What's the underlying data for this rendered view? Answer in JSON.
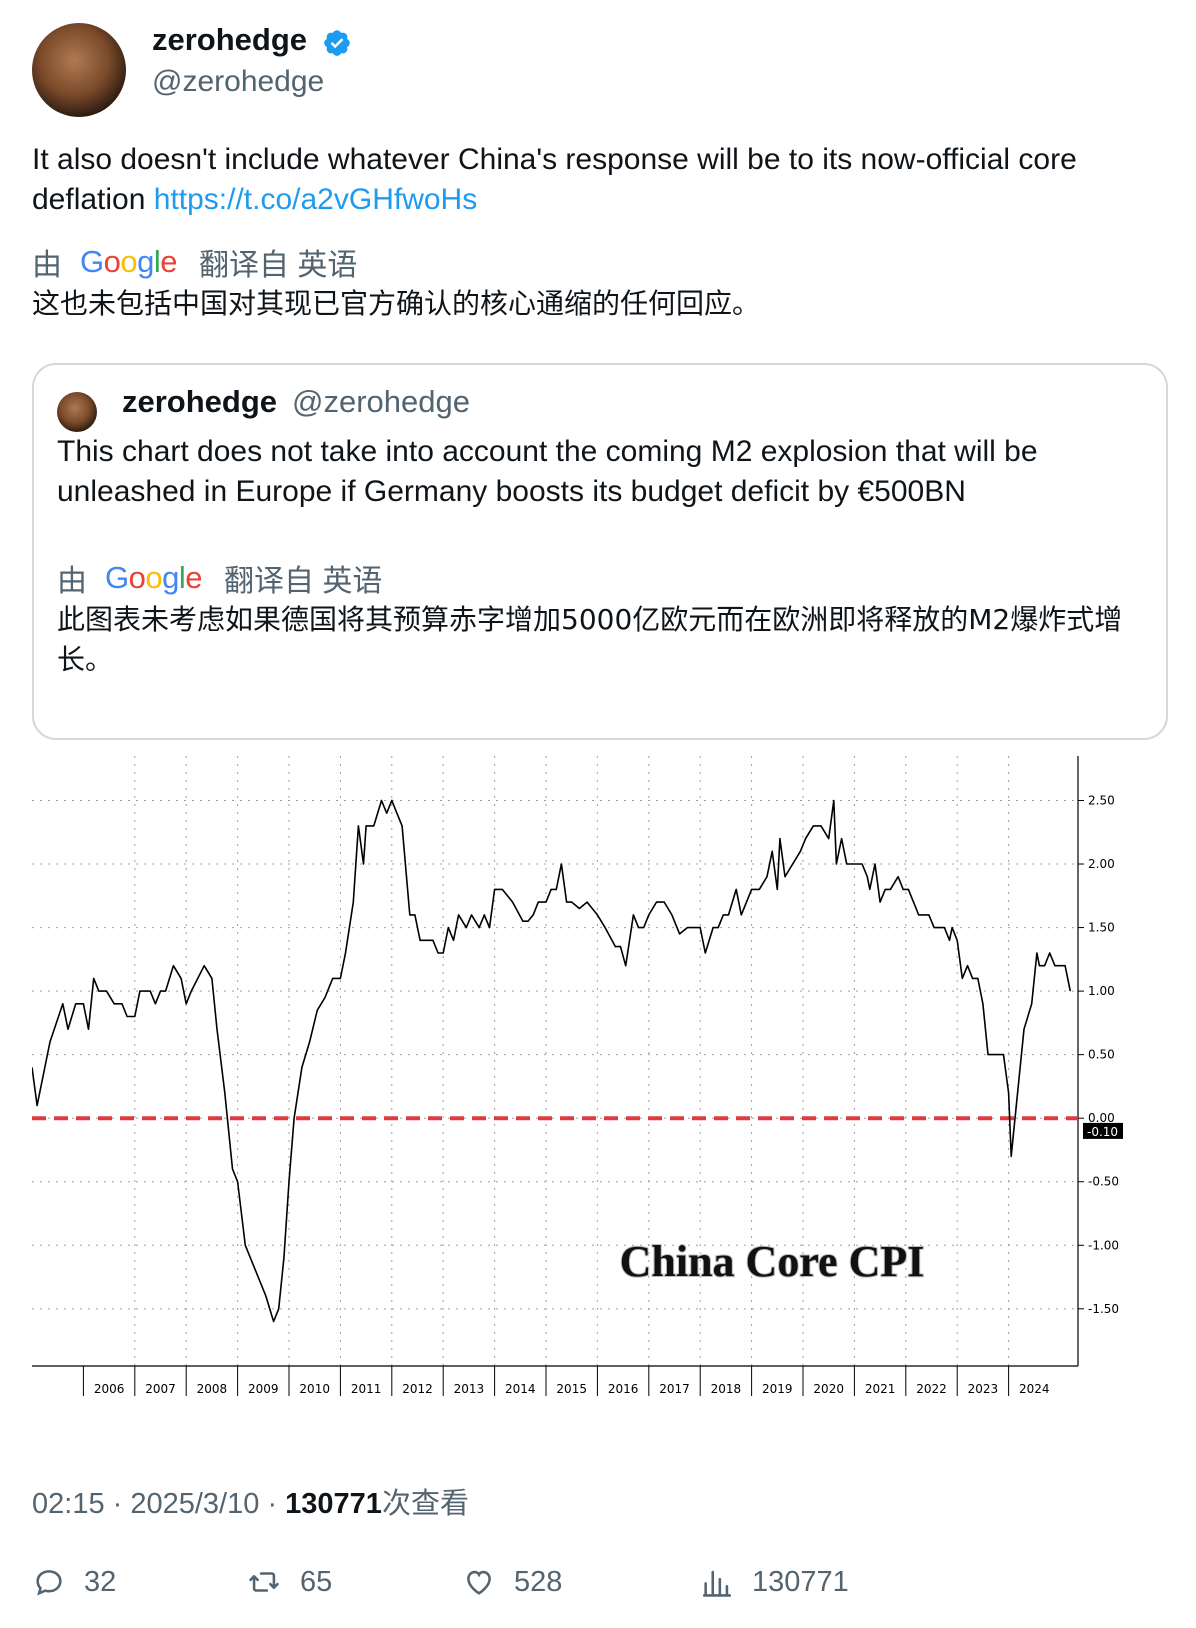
{
  "author": {
    "name": "zerohedge",
    "handle": "@zerohedge"
  },
  "tweet": {
    "text": "It also doesn't include whatever China's response will be to its now-official core deflation ",
    "link": "https://t.co/a2vGHfwoHs",
    "translation_by": "由",
    "translation_from": "翻译自 英语",
    "translation_text": "这也未包括中国对其现已官方确认的核心通缩的任何回应。"
  },
  "quote": {
    "name": "zerohedge",
    "handle": "@zerohedge",
    "text": "This chart does not take into account the coming M2 explosion that will be unleashed in Europe if Germany boosts its budget deficit by €500BN",
    "translation_by": "由",
    "translation_from": "翻译自 英语",
    "translation_text": "此图表未考虑如果德国将其预算赤字增加5000亿欧元而在欧洲即将释放的M2爆炸式增长。"
  },
  "chart_data": {
    "type": "line",
    "title": "China Core CPI",
    "xlabel": "",
    "ylabel": "",
    "x_ticks": [
      "2006",
      "2007",
      "2008",
      "2009",
      "2010",
      "2011",
      "2012",
      "2013",
      "2014",
      "2015",
      "2016",
      "2017",
      "2018",
      "2019",
      "2020",
      "2021",
      "2022",
      "2023",
      "2024"
    ],
    "y_ticks": [
      "2.50",
      "2.00",
      "1.50",
      "1.00",
      "0.50",
      "0.00",
      "-0.50",
      "-1.00",
      "-1.50"
    ],
    "ylim": [
      -1.95,
      2.85
    ],
    "xlim": [
      2005.0,
      2025.35
    ],
    "reference_line": 0,
    "last_value_label": "-0.10",
    "grid": true,
    "series": [
      {
        "values": [
          [
            2005.0,
            0.4
          ],
          [
            2005.1,
            0.1
          ],
          [
            2005.35,
            0.6
          ],
          [
            2005.6,
            0.9
          ],
          [
            2005.7,
            0.7
          ],
          [
            2005.85,
            0.9
          ],
          [
            2006.0,
            0.9
          ],
          [
            2006.1,
            0.7
          ],
          [
            2006.2,
            1.1
          ],
          [
            2006.3,
            1.0
          ],
          [
            2006.45,
            1.0
          ],
          [
            2006.6,
            0.9
          ],
          [
            2006.75,
            0.9
          ],
          [
            2006.85,
            0.8
          ],
          [
            2007.0,
            0.8
          ],
          [
            2007.1,
            1.0
          ],
          [
            2007.3,
            1.0
          ],
          [
            2007.4,
            0.9
          ],
          [
            2007.5,
            1.0
          ],
          [
            2007.6,
            1.0
          ],
          [
            2007.75,
            1.2
          ],
          [
            2007.9,
            1.1
          ],
          [
            2008.0,
            0.9
          ],
          [
            2008.1,
            1.0
          ],
          [
            2008.35,
            1.2
          ],
          [
            2008.5,
            1.1
          ],
          [
            2008.6,
            0.7
          ],
          [
            2008.75,
            0.2
          ],
          [
            2008.9,
            -0.4
          ],
          [
            2009.0,
            -0.5
          ],
          [
            2009.15,
            -1.0
          ],
          [
            2009.35,
            -1.2
          ],
          [
            2009.55,
            -1.4
          ],
          [
            2009.7,
            -1.6
          ],
          [
            2009.8,
            -1.5
          ],
          [
            2009.9,
            -1.1
          ],
          [
            2010.0,
            -0.5
          ],
          [
            2010.1,
            0.0
          ],
          [
            2010.25,
            0.4
          ],
          [
            2010.4,
            0.6
          ],
          [
            2010.55,
            0.85
          ],
          [
            2010.7,
            0.95
          ],
          [
            2010.85,
            1.1
          ],
          [
            2011.0,
            1.1
          ],
          [
            2011.1,
            1.3
          ],
          [
            2011.25,
            1.7
          ],
          [
            2011.35,
            2.3
          ],
          [
            2011.45,
            2.0
          ],
          [
            2011.5,
            2.3
          ],
          [
            2011.65,
            2.3
          ],
          [
            2011.8,
            2.5
          ],
          [
            2011.9,
            2.4
          ],
          [
            2012.0,
            2.5
          ],
          [
            2012.1,
            2.4
          ],
          [
            2012.2,
            2.3
          ],
          [
            2012.35,
            1.6
          ],
          [
            2012.45,
            1.6
          ],
          [
            2012.55,
            1.4
          ],
          [
            2012.7,
            1.4
          ],
          [
            2012.8,
            1.4
          ],
          [
            2012.9,
            1.3
          ],
          [
            2013.0,
            1.3
          ],
          [
            2013.1,
            1.5
          ],
          [
            2013.2,
            1.4
          ],
          [
            2013.3,
            1.6
          ],
          [
            2013.45,
            1.5
          ],
          [
            2013.55,
            1.6
          ],
          [
            2013.7,
            1.5
          ],
          [
            2013.8,
            1.6
          ],
          [
            2013.9,
            1.5
          ],
          [
            2014.0,
            1.8
          ],
          [
            2014.15,
            1.8
          ],
          [
            2014.35,
            1.7
          ],
          [
            2014.55,
            1.55
          ],
          [
            2014.65,
            1.55
          ],
          [
            2014.75,
            1.6
          ],
          [
            2014.85,
            1.7
          ],
          [
            2015.0,
            1.7
          ],
          [
            2015.1,
            1.8
          ],
          [
            2015.2,
            1.8
          ],
          [
            2015.3,
            2.0
          ],
          [
            2015.4,
            1.7
          ],
          [
            2015.5,
            1.7
          ],
          [
            2015.65,
            1.65
          ],
          [
            2015.8,
            1.7
          ],
          [
            2016.0,
            1.6
          ],
          [
            2016.15,
            1.5
          ],
          [
            2016.35,
            1.35
          ],
          [
            2016.45,
            1.35
          ],
          [
            2016.55,
            1.2
          ],
          [
            2016.7,
            1.6
          ],
          [
            2016.8,
            1.5
          ],
          [
            2016.9,
            1.5
          ],
          [
            2017.0,
            1.6
          ],
          [
            2017.15,
            1.7
          ],
          [
            2017.3,
            1.7
          ],
          [
            2017.45,
            1.6
          ],
          [
            2017.6,
            1.45
          ],
          [
            2017.75,
            1.5
          ],
          [
            2017.85,
            1.5
          ],
          [
            2018.0,
            1.5
          ],
          [
            2018.1,
            1.3
          ],
          [
            2018.25,
            1.5
          ],
          [
            2018.35,
            1.5
          ],
          [
            2018.45,
            1.6
          ],
          [
            2018.55,
            1.6
          ],
          [
            2018.7,
            1.8
          ],
          [
            2018.8,
            1.6
          ],
          [
            2018.9,
            1.7
          ],
          [
            2019.0,
            1.8
          ],
          [
            2019.15,
            1.8
          ],
          [
            2019.3,
            1.9
          ],
          [
            2019.4,
            2.1
          ],
          [
            2019.5,
            1.8
          ],
          [
            2019.55,
            2.2
          ],
          [
            2019.65,
            1.9
          ],
          [
            2019.8,
            2.0
          ],
          [
            2019.95,
            2.1
          ],
          [
            2020.05,
            2.2
          ],
          [
            2020.2,
            2.3
          ],
          [
            2020.35,
            2.3
          ],
          [
            2020.5,
            2.2
          ],
          [
            2020.6,
            2.5
          ],
          [
            2020.65,
            2.0
          ],
          [
            2020.75,
            2.2
          ],
          [
            2020.85,
            2.0
          ],
          [
            2020.95,
            2.0
          ],
          [
            2021.05,
            2.0
          ],
          [
            2021.15,
            2.0
          ],
          [
            2021.25,
            1.9
          ],
          [
            2021.3,
            1.8
          ],
          [
            2021.4,
            2.0
          ],
          [
            2021.5,
            1.7
          ],
          [
            2021.6,
            1.8
          ],
          [
            2021.7,
            1.8
          ],
          [
            2021.85,
            1.9
          ],
          [
            2021.95,
            1.8
          ],
          [
            2022.05,
            1.8
          ],
          [
            2022.15,
            1.7
          ],
          [
            2022.25,
            1.6
          ],
          [
            2022.35,
            1.6
          ],
          [
            2022.45,
            1.6
          ],
          [
            2022.55,
            1.5
          ],
          [
            2022.65,
            1.5
          ],
          [
            2022.75,
            1.5
          ],
          [
            2022.85,
            1.4
          ],
          [
            2022.9,
            1.5
          ],
          [
            2023.0,
            1.4
          ],
          [
            2023.1,
            1.1
          ],
          [
            2023.2,
            1.2
          ],
          [
            2023.3,
            1.1
          ],
          [
            2023.4,
            1.1
          ],
          [
            2023.5,
            0.9
          ],
          [
            2023.6,
            0.5
          ],
          [
            2023.7,
            0.5
          ],
          [
            2023.8,
            0.5
          ],
          [
            2023.9,
            0.5
          ],
          [
            2024.0,
            0.2
          ],
          [
            2024.05,
            -0.3
          ],
          [
            2024.15,
            0.1
          ],
          [
            2024.3,
            0.7
          ],
          [
            2024.45,
            0.9
          ],
          [
            2024.55,
            1.3
          ],
          [
            2024.6,
            1.2
          ],
          [
            2024.7,
            1.2
          ],
          [
            2024.8,
            1.3
          ],
          [
            2024.9,
            1.2
          ],
          [
            2025.0,
            1.2
          ],
          [
            2025.1,
            1.2
          ],
          [
            2025.2,
            1.0
          ]
        ]
      }
    ]
  },
  "meta": {
    "time": "02:15",
    "date": "2025/3/10",
    "views": "130771",
    "views_label": "次查看"
  },
  "actions": {
    "replies": "32",
    "reposts": "65",
    "likes": "528",
    "views": "130771"
  },
  "colors": {
    "link": "#1d9bf0",
    "muted": "#536471",
    "verified": "#1d9bf0",
    "zero_line": "#e03a3e"
  }
}
